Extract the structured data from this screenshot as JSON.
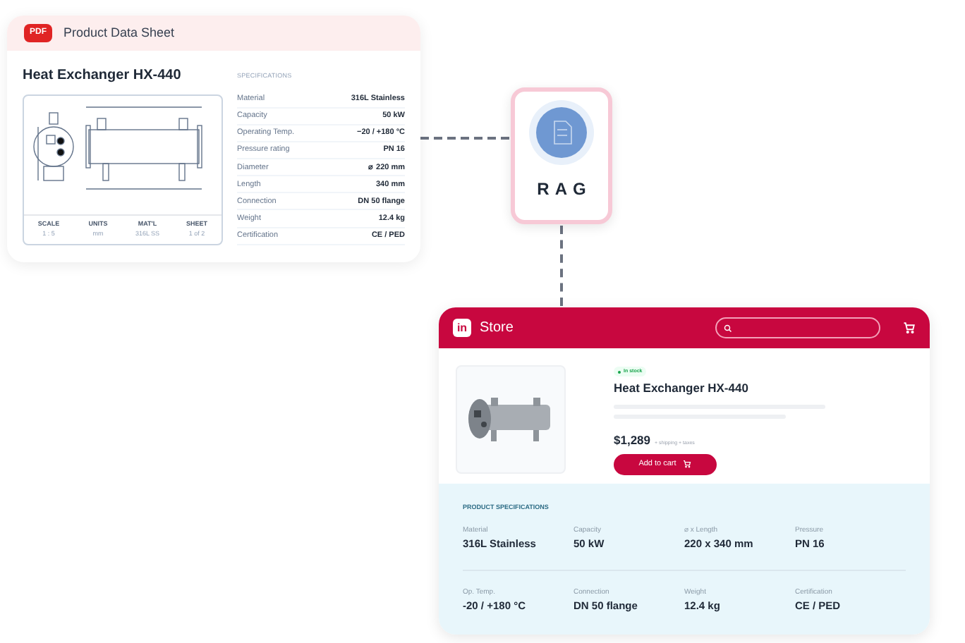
{
  "datasheet": {
    "badge": "PDF",
    "title": "Product Data Sheet",
    "product": "Heat Exchanger HX-440",
    "drawing_footer": [
      {
        "label": "SCALE",
        "value": "1 : 5"
      },
      {
        "label": "UNITS",
        "value": "mm"
      },
      {
        "label": "MAT'L",
        "value": "316L SS"
      },
      {
        "label": "SHEET",
        "value": "1 of 2"
      }
    ],
    "specs_heading": "SPECIFICATIONS",
    "specs": [
      {
        "label": "Material",
        "value": "316L Stainless"
      },
      {
        "label": "Capacity",
        "value": "50 kW"
      },
      {
        "label": "Operating Temp.",
        "value": "−20 / +180 °C"
      },
      {
        "label": "Pressure rating",
        "value": "PN 16"
      },
      {
        "label": "Diameter",
        "value": "⌀ 220 mm"
      },
      {
        "label": "Length",
        "value": "340 mm"
      },
      {
        "label": "Connection",
        "value": "DN 50 flange"
      },
      {
        "label": "Weight",
        "value": "12.4 kg"
      },
      {
        "label": "Certification",
        "value": "CE / PED"
      }
    ]
  },
  "rag": {
    "label": "RAG"
  },
  "store": {
    "logo": "in",
    "title": "Store",
    "stock": "In stock",
    "product": "Heat Exchanger HX-440",
    "price": "$1,289",
    "price_note": "+ shipping + taxes",
    "cart_button": "Add to cart",
    "specs_heading": "PRODUCT SPECIFICATIONS",
    "specs": [
      {
        "label": "Material",
        "value": "316L Stainless"
      },
      {
        "label": "Capacity",
        "value": "50 kW"
      },
      {
        "label": "⌀ x Length",
        "value": "220 x 340 mm"
      },
      {
        "label": "Pressure",
        "value": "PN 16"
      },
      {
        "label": "Op. Temp.",
        "value": "-20 / +180 °C"
      },
      {
        "label": "Connection",
        "value": "DN 50 flange"
      },
      {
        "label": "Weight",
        "value": "12.4 kg"
      },
      {
        "label": "Certification",
        "value": "CE / PED"
      }
    ]
  }
}
